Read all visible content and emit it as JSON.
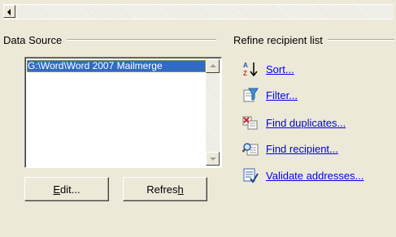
{
  "data_source": {
    "title": "Data Source",
    "selected_item": "G:\\Word\\Word 2007 Mailmerge"
  },
  "buttons": {
    "edit_underlined": "E",
    "edit_rest": "dit...",
    "refresh_prefix": "Refres",
    "refresh_underlined": "h"
  },
  "refine": {
    "title": "Refine recipient list",
    "sort_u": "S",
    "sort_rest": "ort...",
    "filter_u": "F",
    "filter_rest": "ilter...",
    "dups_prefix": "Fin",
    "dups_u": "d",
    "dups_rest": " duplicates...",
    "find_prefix": "Find recipient...",
    "validate_u": "V",
    "validate_rest": "alidate addresses..."
  },
  "icons": {
    "sort": "sort-az-icon",
    "filter": "filter-funnel-icon",
    "dups": "find-duplicates-icon",
    "find": "find-recipient-icon",
    "validate": "validate-addresses-icon"
  }
}
